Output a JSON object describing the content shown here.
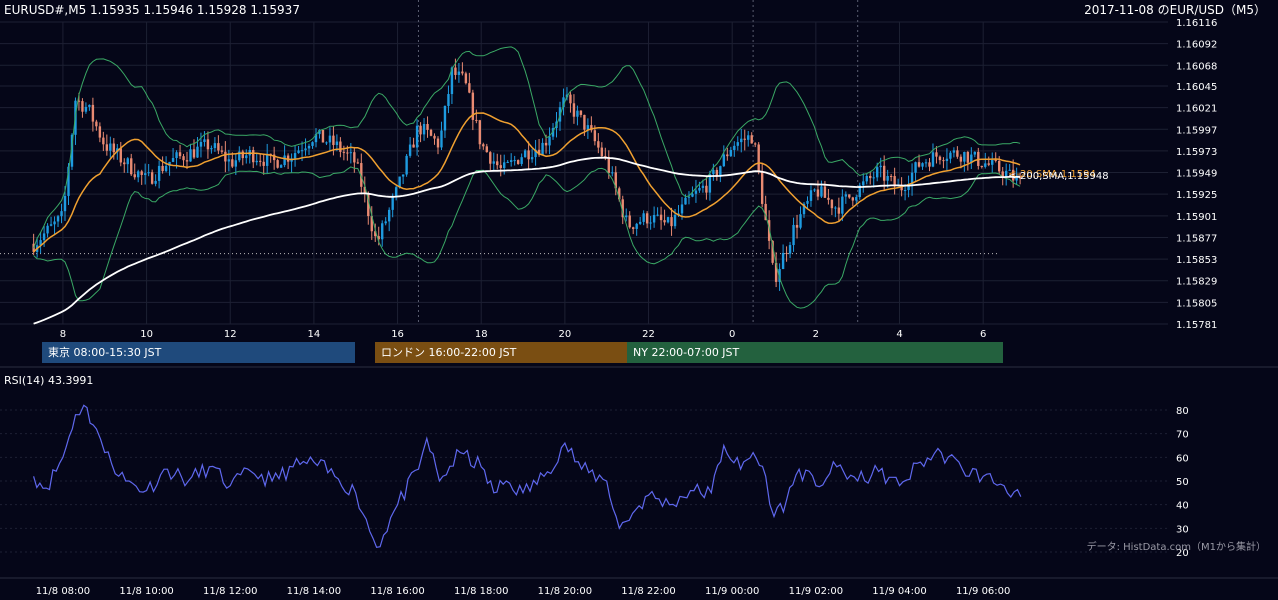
{
  "header": {
    "info": "EURUSD#,M5 1.15935 1.15946 1.15928 1.15937",
    "title": "2017-11-08 のEUR/USD（M5）"
  },
  "rsi_label": "RSI(14) 43.3991",
  "data_source": "データ: HistData.com（M1から集計）",
  "sessions": {
    "tokyo": "東京 08:00-15:30 JST",
    "london": "ロンドン 16:00-22:00 JST",
    "ny": "NY 22:00-07:00 JST"
  },
  "colors": {
    "background": "#050618",
    "bullish": "#1e9be0",
    "bearish": "#e98a72",
    "bollinger": "#3aa865",
    "sma20": "#f0a030",
    "sma200": "#ffffff",
    "rsi": "#5f68ee",
    "grid": "#1d2033"
  },
  "chart_data": [
    {
      "type": "candlestick",
      "symbol": "EURUSD",
      "timeframe": "M5",
      "date": "2017-11-08",
      "ylim": [
        1.15781,
        1.16116
      ],
      "y_ticks": [
        "1.16116",
        "1.16092",
        "1.16068",
        "1.16045",
        "1.16021",
        "1.15997",
        "1.15973",
        "1.15949",
        "1.15925",
        "1.15901",
        "1.15877",
        "1.15853",
        "1.15829",
        "1.15805",
        "1.15781"
      ],
      "x_ticks": [
        "8",
        "10",
        "12",
        "14",
        "16",
        "18",
        "20",
        "22",
        "0",
        "2",
        "4",
        "6"
      ],
      "reference_line": 1.15859,
      "last_close": 1.15937,
      "annotations": [
        "<-20,SMA,1.1594",
        "<-200,SMA,1.15948"
      ],
      "price_path": [
        {
          "t": 7.3,
          "p": 1.1587
        },
        {
          "t": 8.0,
          "p": 1.159
        },
        {
          "t": 8.3,
          "p": 1.1603
        },
        {
          "t": 8.6,
          "p": 1.1602
        },
        {
          "t": 9.0,
          "p": 1.1598
        },
        {
          "t": 9.5,
          "p": 1.1596
        },
        {
          "t": 10.0,
          "p": 1.1594
        },
        {
          "t": 10.5,
          "p": 1.1596
        },
        {
          "t": 11.0,
          "p": 1.1597
        },
        {
          "t": 11.5,
          "p": 1.1598
        },
        {
          "t": 12.0,
          "p": 1.1596
        },
        {
          "t": 12.5,
          "p": 1.1597
        },
        {
          "t": 13.0,
          "p": 1.1596
        },
        {
          "t": 13.5,
          "p": 1.1597
        },
        {
          "t": 14.0,
          "p": 1.1599
        },
        {
          "t": 14.5,
          "p": 1.1598
        },
        {
          "t": 15.0,
          "p": 1.1596
        },
        {
          "t": 15.5,
          "p": 1.1587
        },
        {
          "t": 16.0,
          "p": 1.1593
        },
        {
          "t": 16.5,
          "p": 1.16
        },
        {
          "t": 17.0,
          "p": 1.1598
        },
        {
          "t": 17.3,
          "p": 1.1606
        },
        {
          "t": 17.6,
          "p": 1.1605
        },
        {
          "t": 18.0,
          "p": 1.1598
        },
        {
          "t": 18.5,
          "p": 1.1595
        },
        {
          "t": 19.0,
          "p": 1.1597
        },
        {
          "t": 19.5,
          "p": 1.1598
        },
        {
          "t": 20.0,
          "p": 1.1603
        },
        {
          "t": 20.5,
          "p": 1.16
        },
        {
          "t": 21.0,
          "p": 1.1596
        },
        {
          "t": 21.5,
          "p": 1.1589
        },
        {
          "t": 22.0,
          "p": 1.159
        },
        {
          "t": 22.5,
          "p": 1.1589
        },
        {
          "t": 23.0,
          "p": 1.1592
        },
        {
          "t": 23.5,
          "p": 1.1594
        },
        {
          "t": 24.0,
          "p": 1.1598
        },
        {
          "t": 24.5,
          "p": 1.1599
        },
        {
          "t": 25.0,
          "p": 1.1583
        },
        {
          "t": 25.5,
          "p": 1.1589
        },
        {
          "t": 26.0,
          "p": 1.1593
        },
        {
          "t": 26.5,
          "p": 1.1591
        },
        {
          "t": 27.0,
          "p": 1.1593
        },
        {
          "t": 27.5,
          "p": 1.1595
        },
        {
          "t": 28.0,
          "p": 1.1593
        },
        {
          "t": 28.5,
          "p": 1.1596
        },
        {
          "t": 29.0,
          "p": 1.1597
        },
        {
          "t": 29.5,
          "p": 1.1597
        },
        {
          "t": 30.0,
          "p": 1.1596
        },
        {
          "t": 30.5,
          "p": 1.1595
        },
        {
          "t": 30.9,
          "p": 1.15937
        }
      ]
    },
    {
      "type": "line",
      "title": "RSI(14) 43.3991",
      "ylim": [
        20,
        80
      ],
      "y_ticks": [
        "80",
        "70",
        "60",
        "50",
        "40",
        "30",
        "20"
      ],
      "x_ticks": [
        "11/8 08:00",
        "11/8 10:00",
        "11/8 12:00",
        "11/8 14:00",
        "11/8 16:00",
        "11/8 18:00",
        "11/8 20:00",
        "11/8 22:00",
        "11/9 00:00",
        "11/9 02:00",
        "11/9 04:00",
        "11/9 06:00"
      ],
      "points": [
        {
          "t": 7.3,
          "v": 52
        },
        {
          "t": 7.6,
          "v": 47
        },
        {
          "t": 8.0,
          "v": 60
        },
        {
          "t": 8.3,
          "v": 78
        },
        {
          "t": 8.5,
          "v": 82
        },
        {
          "t": 8.8,
          "v": 72
        },
        {
          "t": 9.0,
          "v": 62
        },
        {
          "t": 9.5,
          "v": 50
        },
        {
          "t": 10.0,
          "v": 46
        },
        {
          "t": 10.5,
          "v": 55
        },
        {
          "t": 11.0,
          "v": 50
        },
        {
          "t": 11.5,
          "v": 56
        },
        {
          "t": 12.0,
          "v": 48
        },
        {
          "t": 12.5,
          "v": 54
        },
        {
          "t": 13.0,
          "v": 50
        },
        {
          "t": 13.5,
          "v": 56
        },
        {
          "t": 14.0,
          "v": 58
        },
        {
          "t": 14.5,
          "v": 52
        },
        {
          "t": 15.0,
          "v": 45
        },
        {
          "t": 15.5,
          "v": 22
        },
        {
          "t": 16.0,
          "v": 40
        },
        {
          "t": 16.5,
          "v": 55
        },
        {
          "t": 16.7,
          "v": 68
        },
        {
          "t": 17.0,
          "v": 50
        },
        {
          "t": 17.5,
          "v": 62
        },
        {
          "t": 18.0,
          "v": 56
        },
        {
          "t": 18.3,
          "v": 45
        },
        {
          "t": 18.6,
          "v": 50
        },
        {
          "t": 19.0,
          "v": 45
        },
        {
          "t": 19.5,
          "v": 52
        },
        {
          "t": 20.0,
          "v": 66
        },
        {
          "t": 20.4,
          "v": 55
        },
        {
          "t": 21.0,
          "v": 50
        },
        {
          "t": 21.3,
          "v": 30
        },
        {
          "t": 21.7,
          "v": 38
        },
        {
          "t": 22.0,
          "v": 44
        },
        {
          "t": 22.5,
          "v": 40
        },
        {
          "t": 23.0,
          "v": 46
        },
        {
          "t": 23.5,
          "v": 45
        },
        {
          "t": 23.8,
          "v": 65
        },
        {
          "t": 24.2,
          "v": 55
        },
        {
          "t": 24.5,
          "v": 62
        },
        {
          "t": 24.8,
          "v": 52
        },
        {
          "t": 25.0,
          "v": 35
        },
        {
          "t": 25.3,
          "v": 42
        },
        {
          "t": 25.6,
          "v": 55
        },
        {
          "t": 26.0,
          "v": 48
        },
        {
          "t": 26.5,
          "v": 56
        },
        {
          "t": 27.0,
          "v": 50
        },
        {
          "t": 27.5,
          "v": 54
        },
        {
          "t": 28.0,
          "v": 48
        },
        {
          "t": 28.5,
          "v": 58
        },
        {
          "t": 29.0,
          "v": 62
        },
        {
          "t": 29.5,
          "v": 55
        },
        {
          "t": 30.0,
          "v": 52
        },
        {
          "t": 30.5,
          "v": 48
        },
        {
          "t": 30.9,
          "v": 43.4
        }
      ]
    }
  ]
}
